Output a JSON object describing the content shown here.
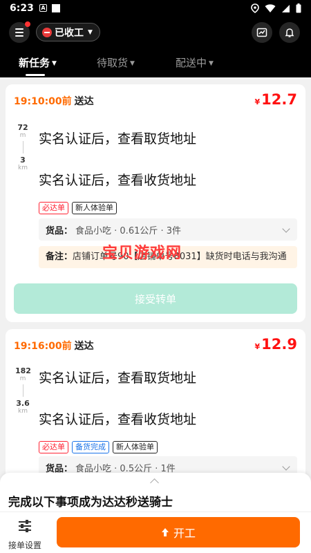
{
  "status_bar": {
    "time": "6:23",
    "notif_a": "A"
  },
  "header": {
    "work_status": "已收工"
  },
  "tabs": [
    {
      "label": "新任务",
      "active": true
    },
    {
      "label": "待取货",
      "active": false
    },
    {
      "label": "配送中",
      "active": false
    }
  ],
  "orders": [
    {
      "deadline_time": "19:10:00前",
      "deadline_label": "送达",
      "price_symbol": "¥",
      "price": "12.7",
      "pickup_distance_value": "72",
      "pickup_distance_unit": "m",
      "delivery_distance_value": "3",
      "delivery_distance_unit": "km",
      "pickup_address": "实名认证后，查看取货地址",
      "delivery_address": "实名认证后，查看收货地址",
      "tags": [
        "必达单",
        "新人体验单"
      ],
      "goods_label": "货品：",
      "goods_info": "食品小吃 · 0.61公斤 · 3件",
      "remark_label": "备注：",
      "remark_text": "店铺订单号90【店铺单号8031】缺货时电话与我沟通",
      "accept_button": "接受转单"
    },
    {
      "deadline_time": "19:16:00前",
      "deadline_label": "送达",
      "price_symbol": "¥",
      "price": "12.9",
      "pickup_distance_value": "182",
      "pickup_distance_unit": "m",
      "delivery_distance_value": "3.6",
      "delivery_distance_unit": "km",
      "pickup_address": "实名认证后，查看取货地址",
      "delivery_address": "实名认证后，查看收货地址",
      "tags": [
        "必达单",
        "备货完成",
        "新人体验单"
      ],
      "goods_label": "货品：",
      "goods_info": "食品小吃 · 0.5公斤 · 1件"
    }
  ],
  "watermark": "宝贝游戏网",
  "bottom_sheet": {
    "title": "完成以下事项成为达达秒送骑士"
  },
  "bottom_bar": {
    "settings_label": "接单设置",
    "start_label": "开工"
  },
  "colors": {
    "accent": "#ff6a00",
    "price": "#ff1111",
    "accept_disabled": "#b3ead8"
  }
}
